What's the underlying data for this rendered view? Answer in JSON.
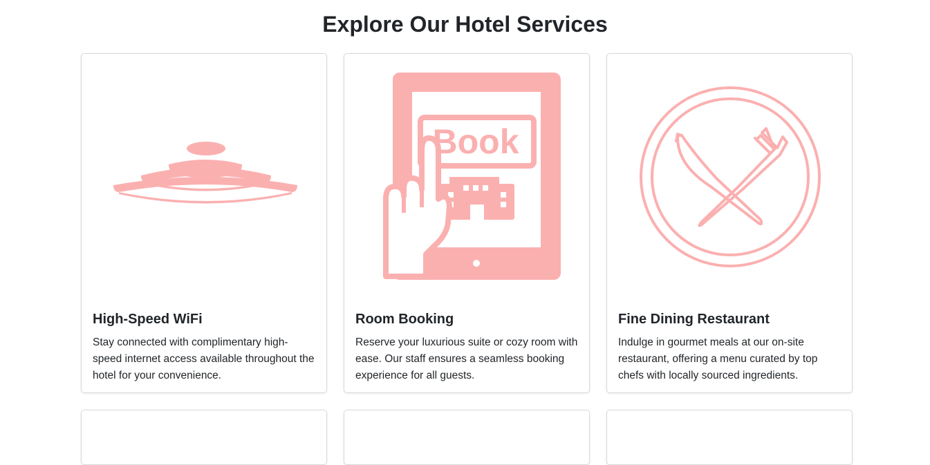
{
  "page": {
    "title": "Explore Our Hotel Services"
  },
  "colors": {
    "icon": "#fbb0b0",
    "text": "#212529",
    "border": "#d9d9d9"
  },
  "services": [
    {
      "icon": "wifi-icon",
      "title": "High-Speed WiFi",
      "description": "Stay connected with complimentary high-speed internet access available throughout the hotel for your convenience."
    },
    {
      "icon": "tablet-book-icon",
      "title": "Room Booking",
      "description": "Reserve your luxurious suite or cozy room with ease. Our staff ensures a seamless booking experience for all guests.",
      "icon_text": "Book"
    },
    {
      "icon": "plate-fork-knife-icon",
      "title": "Fine Dining Restaurant",
      "description": "Indulge in gourmet meals at our on-site restaurant, offering a menu curated by top chefs with locally sourced ingredients."
    }
  ]
}
